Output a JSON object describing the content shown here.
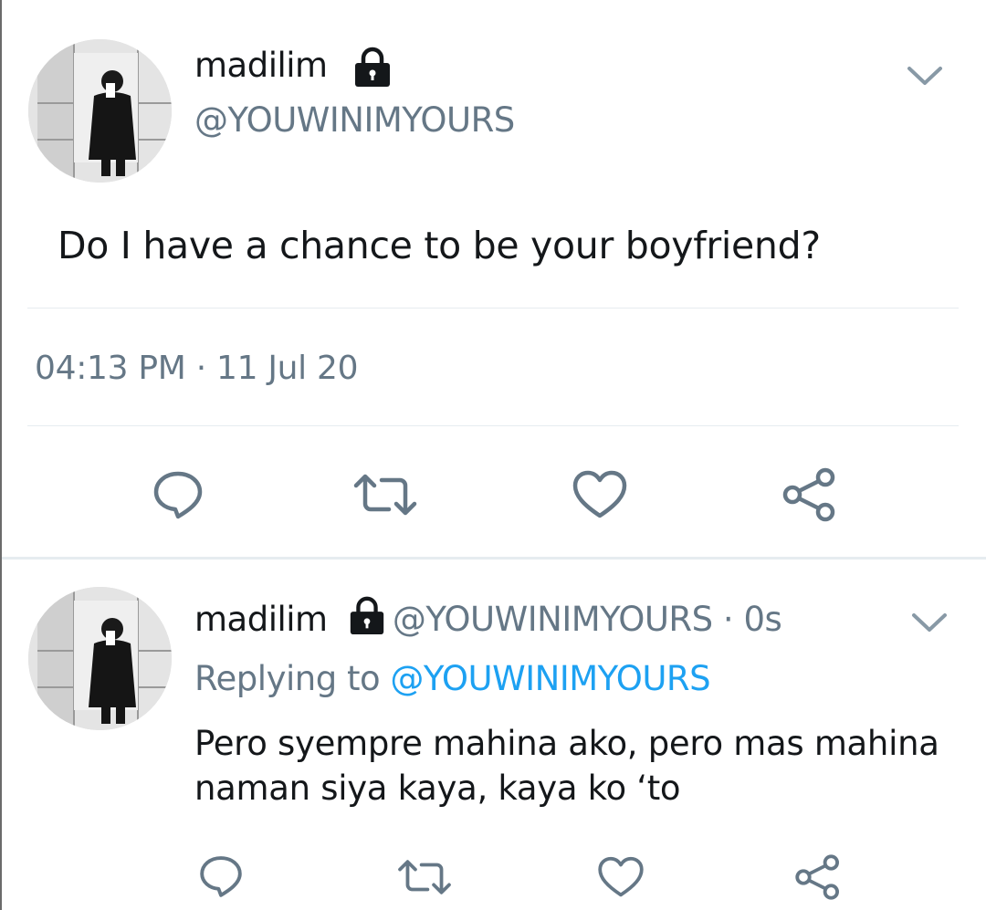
{
  "main_tweet": {
    "display_name": "madilim",
    "handle": "@YOUWINIMYOURS",
    "text": "Do I have a chance to be your boyfriend?",
    "timestamp": "04:13 PM · 11 Jul 20",
    "icons": {
      "lock": "lock-icon",
      "menu": "chevron-down-icon",
      "reply": "reply-icon",
      "retweet": "retweet-icon",
      "like": "heart-icon",
      "share": "share-icon"
    }
  },
  "reply_tweet": {
    "display_name": "madilim",
    "handle": "@YOUWINIMYOURS",
    "separator": " · ",
    "time_ago": "0s",
    "replying_prefix": "Replying to ",
    "replying_to": "@YOUWINIMYOURS",
    "text": "Pero syempre mahina ako, pero mas mahina naman siya kaya, kaya ko ‘to"
  },
  "colors": {
    "text_primary": "#14171a",
    "text_secondary": "#657786",
    "link": "#1da1f2",
    "icon": "#657786",
    "divider": "#e6ecf0"
  }
}
